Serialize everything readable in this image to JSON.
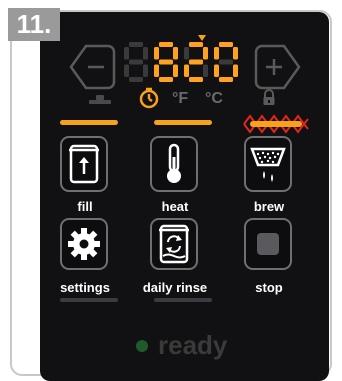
{
  "step": {
    "number": "11."
  },
  "display": {
    "value": "820",
    "digit_color": "#ffa21f",
    "dim_color": "#3a3a3a"
  },
  "controls": {
    "minus_label": "−",
    "plus_label": "+"
  },
  "status": {
    "unit_f": "°F",
    "unit_c": "°C",
    "accent": "#f7a21b",
    "alert": "#e2261c",
    "lock_icon": "lock-icon",
    "timer_icon": "timer-icon",
    "lid_icon": "lid-icon"
  },
  "buttons": [
    {
      "label": "fill",
      "icon": "fill-icon"
    },
    {
      "label": "heat",
      "icon": "thermometer-icon"
    },
    {
      "label": "brew",
      "icon": "brew-icon"
    },
    {
      "label": "settings",
      "icon": "gear-icon"
    },
    {
      "label": "daily rinse",
      "icon": "rinse-icon"
    },
    {
      "label": "stop",
      "icon": "stop-icon"
    }
  ],
  "footer": {
    "ready_text": "ready",
    "ready_color": "#1f5b2a"
  }
}
